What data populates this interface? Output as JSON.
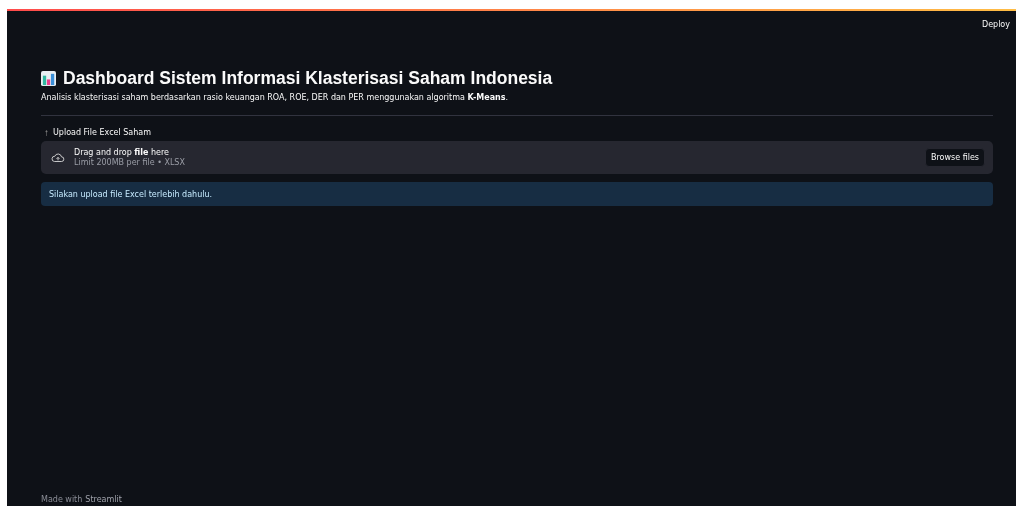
{
  "header": {
    "deploy": "Deploy"
  },
  "title": "Dashboard Sistem Informasi Klasterisasi Saham Indonesia",
  "subtitle": "Analisis klasterisasi saham berdasarkan rasio keuangan ROA, ROE, DER dan PER menggunakan algoritma **K-Means**.",
  "uploader": {
    "label": "Upload File Excel Saham",
    "drop_text": "Drag and drop **file** here",
    "limit": "Limit 200MB per file • XLSX",
    "button": "Browse files"
  },
  "info": "Silakan upload file Excel terlebih dahulu.",
  "footer": {
    "text": "Made with",
    "brand": "Streamlit"
  }
}
